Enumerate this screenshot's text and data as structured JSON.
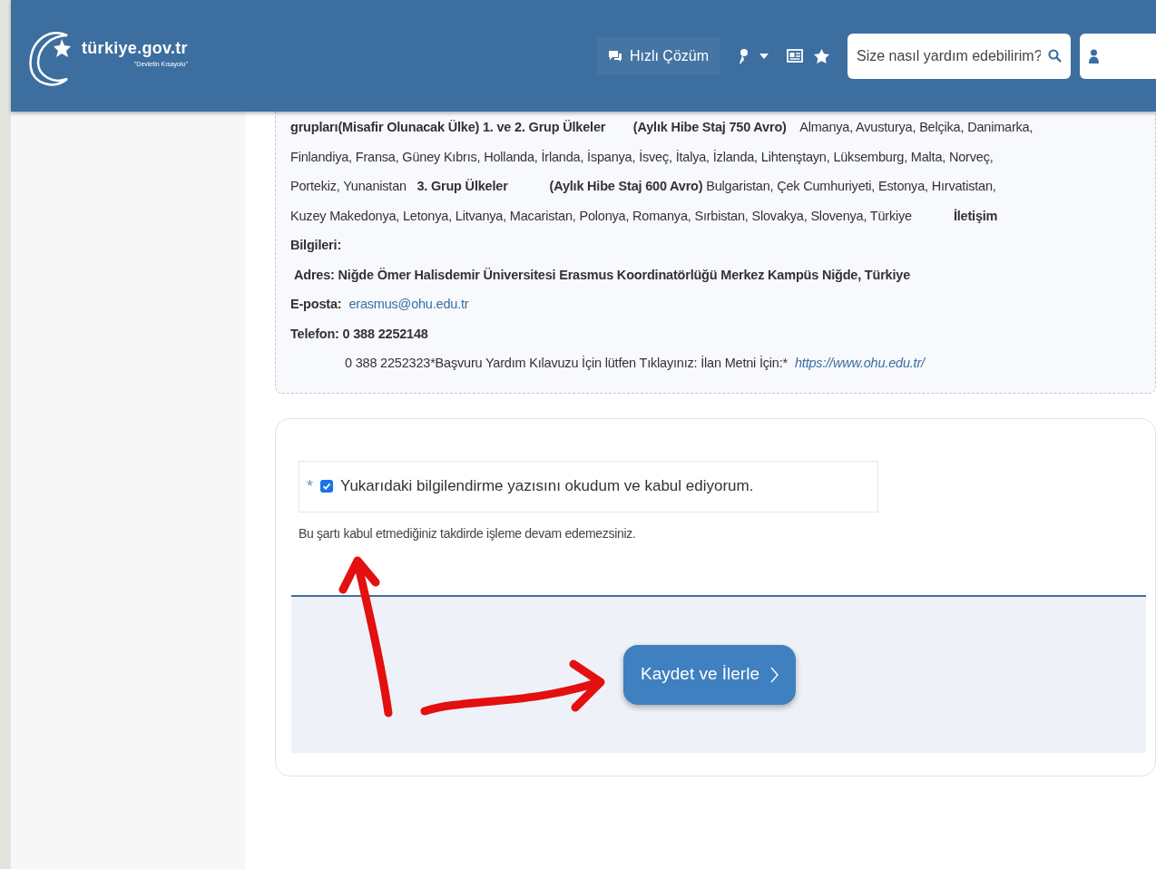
{
  "header": {
    "logo_text": "türkiye.gov.tr",
    "logo_tagline": "\"Devletin Kısayolu\"",
    "quick_help": "Hızlı Çözüm",
    "search": {
      "placeholder": "Size nasıl yardım edebilirim?"
    }
  },
  "announcement_lines": [
    {
      "segments": [
        {
          "kind": "text",
          "text": "**grupları(Misafir Olunacak Ülke) 1. ve 2. Grup Ülkeler        (Aylık Hibe Staj 750 Avro)**    Almanya, Avusturya, Belçika, Danimarka,"
        }
      ]
    },
    {
      "segments": [
        {
          "kind": "text",
          "text": "Finlandiya, Fransa, Güney Kıbrıs, Hollanda, İrlanda, İspanya, İsveç, İtalya, İzlanda, Lihtenştayn, Lüksemburg, Malta, Norveç,"
        }
      ]
    },
    {
      "segments": [
        {
          "kind": "text",
          "text": "Portekiz, Yunanistan   **3. Grup Ülkeler            (Aylık Hibe Staj 600 Avro)** Bulgaristan, Çek Cumhuriyeti, Estonya, Hırvatistan,"
        }
      ]
    },
    {
      "segments": [
        {
          "kind": "text",
          "text": "Kuzey Makedonya, Letonya, Litvanya, Macaristan, Polonya, Romanya, Sırbistan, Slovakya, Slovenya, Türkiye            **İletişim**"
        }
      ]
    },
    {
      "segments": [
        {
          "kind": "text",
          "text": "**Bilgileri:**"
        }
      ]
    },
    {
      "segments": [
        {
          "kind": "text",
          "text": "**Adres: Niğde Ömer Halisdemir Üniversitesi Erasmus Koordinatörlüğü Merkez Kampüs Niğde, Türkiye**"
        }
      ]
    },
    {
      "segments": [
        {
          "kind": "text",
          "text": "**E-posta:**"
        },
        {
          "kind": "link",
          "text": "erasmus@ohu.edu.tr"
        }
      ]
    },
    {
      "segments": [
        {
          "kind": "text",
          "text": "**Telefon: 0 388 2252148**"
        }
      ]
    },
    {
      "segments": [
        {
          "kind": "text",
          "text": "0 388 2252323*Başvuru Yardım Kılavuzu İçin lütfen Tıklayınız: İlan Metni İçin:*"
        },
        {
          "kind": "link",
          "text": "https://www.ohu.edu.tr/"
        }
      ]
    }
  ],
  "consent": {
    "required_mark": "*",
    "checked": true,
    "label": "Yukarıdaki bilgilendirme yazısını okudum ve kabul ediyorum.",
    "hint": "Bu şartı kabul etmediğiniz takdirde işleme devam edemezsiniz."
  },
  "save_button": "Kaydet ve İlerle"
}
